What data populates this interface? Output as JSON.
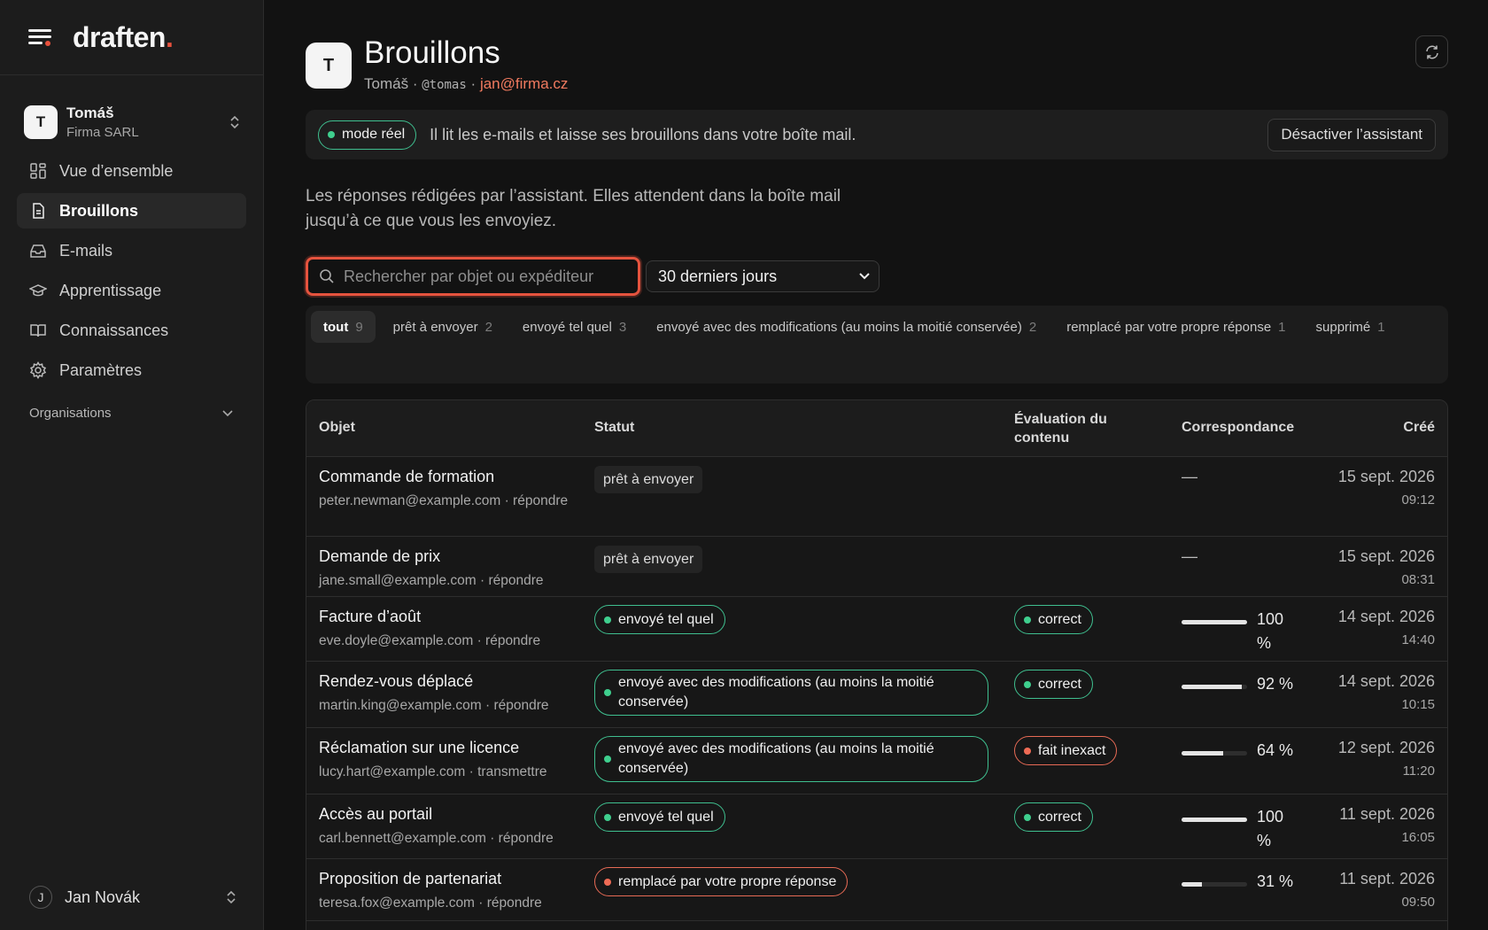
{
  "brand": {
    "name": "draften",
    "dot": "."
  },
  "account": {
    "initial": "T",
    "name": "Tomáš",
    "org": "Firma SARL"
  },
  "nav": [
    {
      "label": "Vue d’ensemble",
      "icon": "grid-icon"
    },
    {
      "label": "Brouillons",
      "icon": "document-icon",
      "active": true
    },
    {
      "label": "E-mails",
      "icon": "inbox-icon"
    },
    {
      "label": "Apprentissage",
      "icon": "graduation-cap-icon"
    },
    {
      "label": "Connaissances",
      "icon": "book-icon"
    },
    {
      "label": "Paramètres",
      "icon": "gear-icon"
    }
  ],
  "organisations_label": "Organisations",
  "user": {
    "initial": "J",
    "name": "Jan Novák"
  },
  "header": {
    "initial": "T",
    "title": "Brouillons",
    "name": "Tomáš",
    "handle": "@tomas",
    "email": "jan@firma.cz",
    "sep": "·"
  },
  "banner": {
    "mode": "mode réel",
    "text": "Il lit les e-mails et laisse ses brouillons dans votre boîte mail.",
    "button": "Désactiver l’assistant"
  },
  "description": "Les réponses rédigées par l’assistant. Elles attendent dans la boîte mail jusqu’à ce que vous les envoyiez.",
  "search": {
    "placeholder": "Rechercher par objet ou expéditeur",
    "value": ""
  },
  "period": {
    "selected": "30 derniers jours"
  },
  "filters": [
    {
      "label": "tout",
      "count": "9",
      "active": true
    },
    {
      "label": "prêt à envoyer",
      "count": "2"
    },
    {
      "label": "envoyé tel quel",
      "count": "3"
    },
    {
      "label": "envoyé avec des modifications (au moins la moitié conservée)",
      "count": "2"
    },
    {
      "label": "remplacé par votre propre réponse",
      "count": "1"
    },
    {
      "label": "supprimé",
      "count": "1"
    }
  ],
  "columns": {
    "subject": "Objet",
    "status": "Statut",
    "evaluation": "Évaluation du contenu",
    "match": "Correspondance",
    "created": "Créé"
  },
  "rows": [
    {
      "subject": "Commande de formation",
      "from": "peter.newman@example.com · répondre",
      "status": "prêt à envoyer",
      "status_kind": "plain",
      "evaluation": "",
      "match": null,
      "match_text": "—",
      "date": "15 sept. 2026",
      "time": "09:12"
    },
    {
      "subject": "Demande de prix",
      "from": "jane.small@example.com · répondre",
      "status": "prêt à envoyer",
      "status_kind": "plain",
      "evaluation": "",
      "match": null,
      "match_text": "—",
      "date": "15 sept. 2026",
      "time": "08:31"
    },
    {
      "subject": "Facture d’août",
      "from": "eve.doyle@example.com · répondre",
      "status": "envoyé tel quel",
      "status_kind": "green",
      "evaluation": "correct",
      "eval_kind": "green",
      "match": 1.0,
      "match_text": "100 %",
      "date": "14 sept. 2026",
      "time": "14:40"
    },
    {
      "subject": "Rendez-vous déplacé",
      "from": "martin.king@example.com · répondre",
      "status": "envoyé avec des modifications (au moins la moitié conservée)",
      "status_kind": "green",
      "evaluation": "correct",
      "eval_kind": "green",
      "match": 0.92,
      "match_text": "92 %",
      "date": "14 sept. 2026",
      "time": "10:15"
    },
    {
      "subject": "Réclamation sur une licence",
      "from": "lucy.hart@example.com · transmettre",
      "status": "envoyé avec des modifications (au moins la moitié conservée)",
      "status_kind": "green",
      "evaluation": "fait inexact",
      "eval_kind": "red",
      "match": 0.64,
      "match_text": "64 %",
      "date": "12 sept. 2026",
      "time": "11:20"
    },
    {
      "subject": "Accès au portail",
      "from": "carl.bennett@example.com · répondre",
      "status": "envoyé tel quel",
      "status_kind": "green",
      "evaluation": "correct",
      "eval_kind": "green",
      "match": 1.0,
      "match_text": "100 %",
      "date": "11 sept. 2026",
      "time": "16:05"
    },
    {
      "subject": "Proposition de partenariat",
      "from": "teresa.fox@example.com · répondre",
      "status": "remplacé par votre propre réponse",
      "status_kind": "red",
      "evaluation": "",
      "match": 0.31,
      "match_text": "31 %",
      "date": "11 sept. 2026",
      "time": "09:50"
    }
  ],
  "colors": {
    "accent": "#e8513d",
    "green": "#3fcf8e",
    "red": "#ef6b55",
    "background": "#121212"
  }
}
